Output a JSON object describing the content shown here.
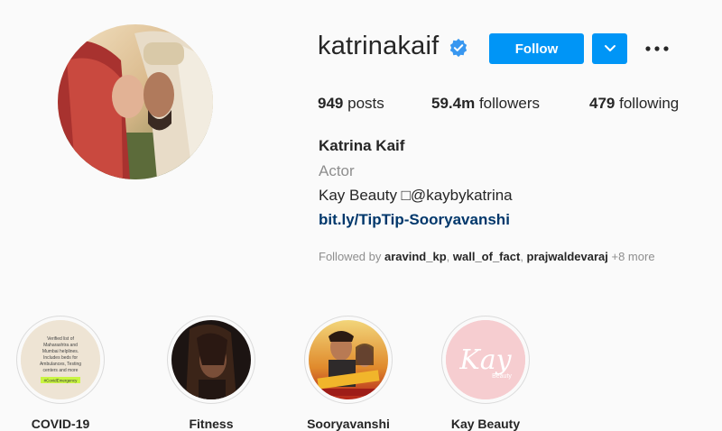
{
  "profile": {
    "username": "katrinakaif",
    "follow_label": "Follow",
    "stats": {
      "posts_count": "949",
      "posts_label": "posts",
      "followers_count": "59.4m",
      "followers_label": "followers",
      "following_count": "479",
      "following_label": "following"
    },
    "full_name": "Katrina Kaif",
    "category": "Actor",
    "bio": "Kay Beauty □@kaybykatrina",
    "link": "bit.ly/TipTip-Sooryavanshi",
    "followed_by": {
      "prefix": "Followed by",
      "names": [
        "aravind_kp",
        "wall_of_fact",
        "prajwaldevaraj"
      ],
      "more": "+8 more"
    }
  },
  "highlights": [
    {
      "label": "COVID-19",
      "icon": "covid-info-card"
    },
    {
      "label": "Fitness",
      "icon": "dark-portrait"
    },
    {
      "label": "Sooryavanshi",
      "icon": "movie-poster"
    },
    {
      "label": "Kay Beauty",
      "icon": "kay-logo",
      "logo_text": "Kay",
      "logo_sub": "Beauty"
    }
  ],
  "covid_card_text": [
    "Verified list of",
    "Maharashtra and",
    "Mumbai helplines.",
    "Includes beds for",
    "Ambulances, Testing",
    "centers and more",
    "#CovidEmergency"
  ],
  "colors": {
    "accent": "#0095f6",
    "verified": "#3897f0",
    "link": "#00376b",
    "kay_bg": "#f6cdd0"
  }
}
